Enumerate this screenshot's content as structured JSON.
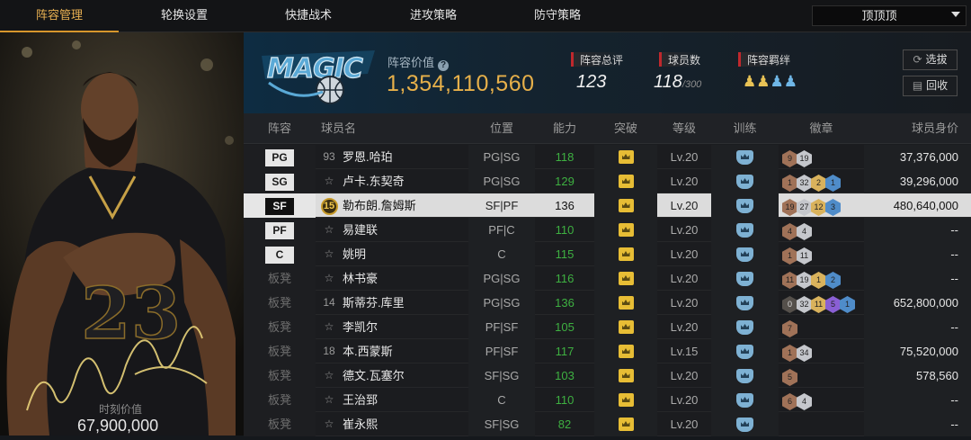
{
  "nav": {
    "tabs": [
      {
        "label": "阵容管理",
        "active": true
      },
      {
        "label": "轮换设置"
      },
      {
        "label": "快捷战术"
      },
      {
        "label": "进攻策略"
      },
      {
        "label": "防守策略"
      }
    ],
    "team_select": "顶顶顶"
  },
  "featured_player": {
    "market_value_label": "时刻价值",
    "market_value": "67,900,000",
    "jersey_number": "23"
  },
  "lineup": {
    "team_logo_text": "MAGIC",
    "value_label": "阵容价值",
    "value": "1,354,110,560",
    "rating_label": "阵容总评",
    "rating": "123",
    "player_count_label": "球员数",
    "player_count": "118",
    "player_count_max": "/300",
    "bond_label": "阵容羁绊",
    "select_button": "选拔",
    "recycle_button": "回收"
  },
  "table": {
    "headers": [
      "阵容",
      "球员名",
      "位置",
      "能力",
      "突破",
      "等级",
      "训练",
      "徽章",
      "球员身价"
    ],
    "rows": [
      {
        "slot": "PG",
        "starter": true,
        "num": "93",
        "name": "罗恩.哈珀",
        "pos": "PG|SG",
        "ability": "118",
        "level": "Lv.20",
        "badges": [
          {
            "t": "bronze",
            "n": "9"
          },
          {
            "t": "silver",
            "n": "19"
          }
        ],
        "value": "37,376,000"
      },
      {
        "slot": "SG",
        "starter": true,
        "num": "",
        "name": "卢卡.东契奇",
        "pos": "PG|SG",
        "ability": "129",
        "level": "Lv.20",
        "badges": [
          {
            "t": "bronze",
            "n": "1"
          },
          {
            "t": "silver",
            "n": "32"
          },
          {
            "t": "gold",
            "n": "2"
          },
          {
            "t": "blue",
            "n": "1"
          }
        ],
        "value": "39,296,000"
      },
      {
        "slot": "SF",
        "starter": true,
        "selected": true,
        "num": "15",
        "name": "勒布朗.詹姆斯",
        "pos": "SF|PF",
        "ability": "136",
        "level": "Lv.20",
        "badges": [
          {
            "t": "bronze",
            "n": "19"
          },
          {
            "t": "silver",
            "n": "27"
          },
          {
            "t": "gold",
            "n": "12"
          },
          {
            "t": "blue",
            "n": "3"
          }
        ],
        "value": "480,640,000"
      },
      {
        "slot": "PF",
        "starter": true,
        "num": "",
        "name": "易建联",
        "pos": "PF|C",
        "ability": "110",
        "level": "Lv.20",
        "badges": [
          {
            "t": "bronze",
            "n": "4"
          },
          {
            "t": "silver",
            "n": "4"
          }
        ],
        "value": "--"
      },
      {
        "slot": "C",
        "starter": true,
        "num": "",
        "name": "姚明",
        "pos": "C",
        "ability": "115",
        "level": "Lv.20",
        "badges": [
          {
            "t": "bronze",
            "n": "1"
          },
          {
            "t": "silver",
            "n": "11"
          }
        ],
        "value": "--"
      },
      {
        "slot": "板凳",
        "num": "",
        "name": "林书豪",
        "pos": "PG|SG",
        "ability": "116",
        "level": "Lv.20",
        "badges": [
          {
            "t": "bronze",
            "n": "11"
          },
          {
            "t": "silver",
            "n": "19"
          },
          {
            "t": "gold",
            "n": "1"
          },
          {
            "t": "blue",
            "n": "2"
          }
        ],
        "value": "--"
      },
      {
        "slot": "板凳",
        "num": "14",
        "name": "斯蒂芬.库里",
        "pos": "PG|SG",
        "ability": "136",
        "level": "Lv.20",
        "badges": [
          {
            "t": "dark",
            "n": "0"
          },
          {
            "t": "silver",
            "n": "32"
          },
          {
            "t": "gold",
            "n": "11"
          },
          {
            "t": "purple",
            "n": "5"
          },
          {
            "t": "blue",
            "n": "1"
          }
        ],
        "value": "652,800,000"
      },
      {
        "slot": "板凳",
        "num": "",
        "name": "李凯尔",
        "pos": "PF|SF",
        "ability": "105",
        "level": "Lv.20",
        "badges": [
          {
            "t": "bronze",
            "n": "7"
          }
        ],
        "value": "--"
      },
      {
        "slot": "板凳",
        "num": "18",
        "name": "本.西蒙斯",
        "pos": "PF|SF",
        "ability": "117",
        "level": "Lv.15",
        "badges": [
          {
            "t": "bronze",
            "n": "1"
          },
          {
            "t": "silver",
            "n": "34"
          }
        ],
        "value": "75,520,000"
      },
      {
        "slot": "板凳",
        "num": "",
        "name": "德文.瓦塞尔",
        "pos": "SF|SG",
        "ability": "103",
        "level": "Lv.20",
        "badges": [
          {
            "t": "bronze",
            "n": "5"
          }
        ],
        "value": "578,560"
      },
      {
        "slot": "板凳",
        "num": "",
        "name": "王治郅",
        "pos": "C",
        "ability": "110",
        "level": "Lv.20",
        "badges": [
          {
            "t": "bronze",
            "n": "6"
          },
          {
            "t": "silver",
            "n": "4"
          }
        ],
        "value": "--"
      },
      {
        "slot": "板凳",
        "num": "",
        "name": "崔永熙",
        "pos": "SF|SG",
        "ability": "82",
        "level": "Lv.20",
        "badges": [],
        "value": "--"
      }
    ]
  }
}
